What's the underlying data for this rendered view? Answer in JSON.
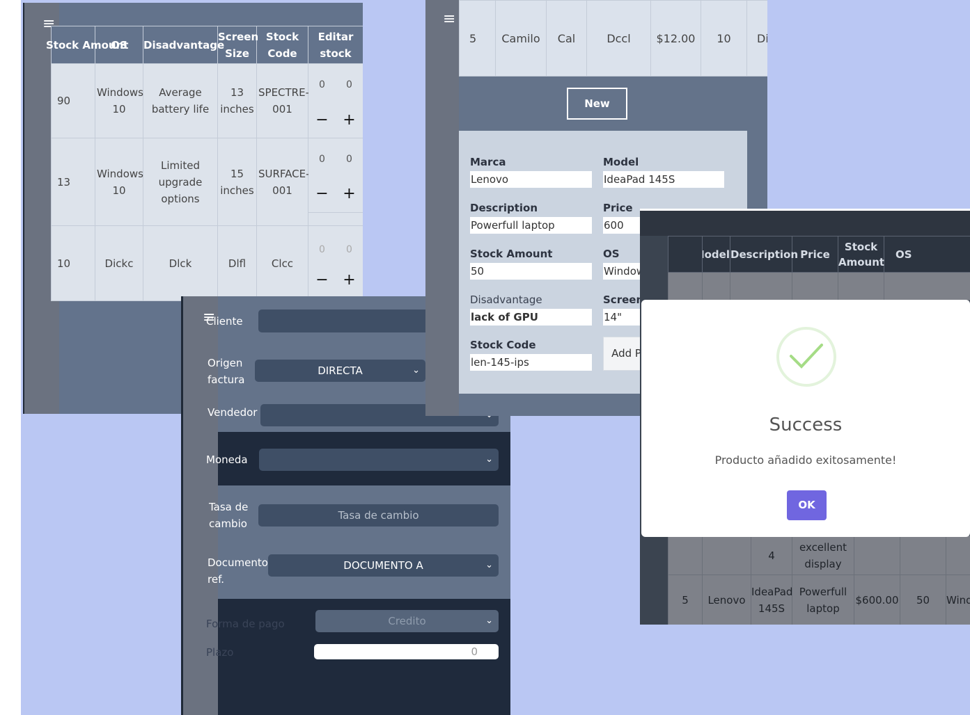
{
  "stock_panel": {
    "headers": [
      "Stock Amount",
      "OS",
      "Disadvantage",
      "Screen Size",
      "Stock Code",
      "Editar stock"
    ],
    "rows": [
      {
        "amount": "90",
        "os": "Windows 10",
        "disadvantage": "Average battery life",
        "screen": "13 inches",
        "code": "SPECTRE-001",
        "n1": "0",
        "n2": "0"
      },
      {
        "amount": "13",
        "os": "Windows 10",
        "disadvantage": "Limited upgrade options",
        "screen": "15 inches",
        "code": "SURFACE-001",
        "n1": "0",
        "n2": "0"
      },
      {
        "amount": "10",
        "os": "Dickc",
        "disadvantage": "Dlck",
        "screen": "Dlfl",
        "code": "Clcc",
        "n1": "0",
        "n2": "0"
      }
    ],
    "minus": "−",
    "plus": "+"
  },
  "invoice_panel": {
    "cliente_label": "Cliente",
    "origen_label": "Origen factura",
    "origen_value": "DIRECTA",
    "vendedor_label": "Vendedor",
    "moneda_label": "Moneda",
    "tasa_label": "Tasa de cambio",
    "tasa_placeholder": "Tasa de cambio",
    "documento_label": "Documento ref.",
    "documento_value": "DOCUMENTO A",
    "forma_pago_label": "Forma de pago",
    "forma_pago_value": "Credito",
    "plazo_label": "Plazo",
    "plazo_value": "0"
  },
  "product_panel": {
    "top_row": [
      "5",
      "Camilo",
      "Cal",
      "Dccl",
      "$12.00",
      "10",
      "Di"
    ],
    "new_label": "New",
    "fields": {
      "marca_label": "Marca",
      "marca_value": "Lenovo",
      "model_label": "Model",
      "model_value": "IdeaPad 145S",
      "description_label": "Description",
      "description_value": "Powerfull laptop",
      "price_label": "Price",
      "price_value": "600",
      "stock_label": "Stock Amount",
      "stock_value": "50",
      "os_label": "OS",
      "os_value": "Windows",
      "disadvantage_label": "Disadvantage",
      "disadvantage_value": "lack of GPU",
      "screen_label": "Screen Size",
      "screen_value": "14\"",
      "code_label": "Stock Code",
      "code_value": "len-145-ips"
    },
    "add_label": "Add Product"
  },
  "list_panel": {
    "headers": [
      "Model",
      "Description",
      "Price",
      "Stock Amount",
      "OS"
    ],
    "row4": {
      "model": "4",
      "description": "excellent display"
    },
    "row5": {
      "id": "5",
      "brand": "Lenovo",
      "model": "IdeaPad 145S",
      "description": "Powerfull laptop",
      "price": "$600.00",
      "stock": "50",
      "os": "Windows"
    }
  },
  "modal": {
    "title": "Success",
    "message": "Producto añadido exitosamente!",
    "ok_label": "OK"
  },
  "colors": {
    "ok_button": "#7066e0",
    "success_check": "#a5dc86",
    "background": "#bac7f3"
  }
}
